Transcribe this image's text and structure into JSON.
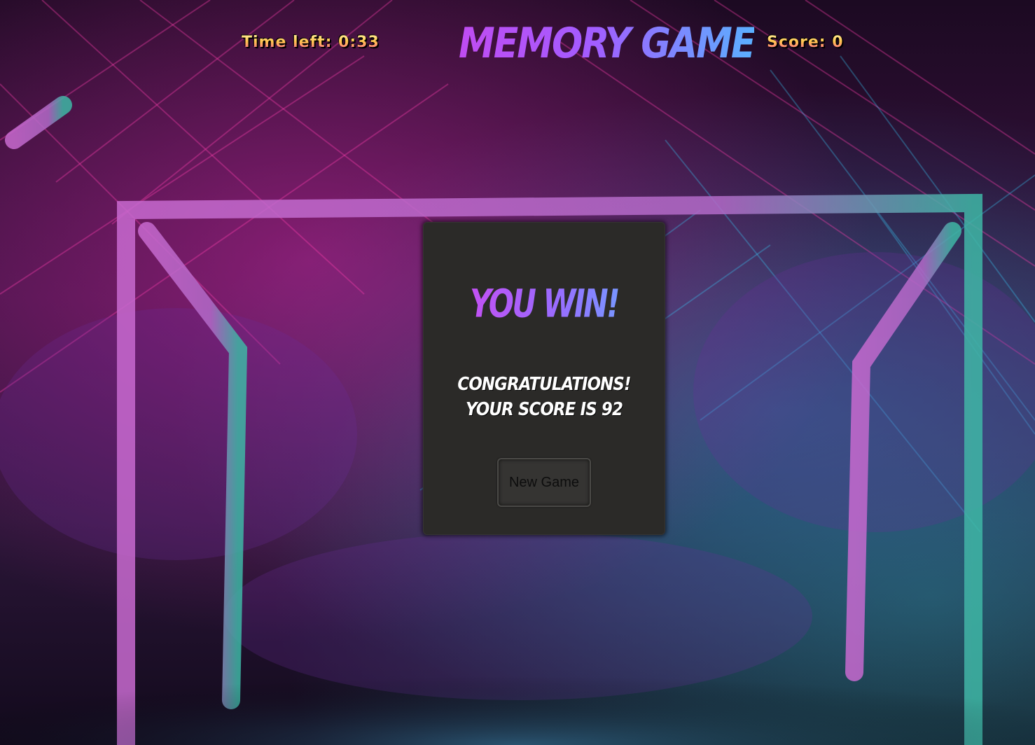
{
  "hud": {
    "time_left": "Time left: 0:33",
    "score": "Score: 0"
  },
  "title": "MEMORY GAME",
  "modal": {
    "heading": "YOU WIN!",
    "message_line1": "CONGRATULATIONS!",
    "message_line2": "YOUR SCORE IS 92",
    "new_game_label": "New Game"
  },
  "colors": {
    "modal_background": "#2b2a28",
    "title_gradient_start": "#c04cf2",
    "title_gradient_end": "#5ab0ff",
    "hud_text": "#ffd86b"
  }
}
